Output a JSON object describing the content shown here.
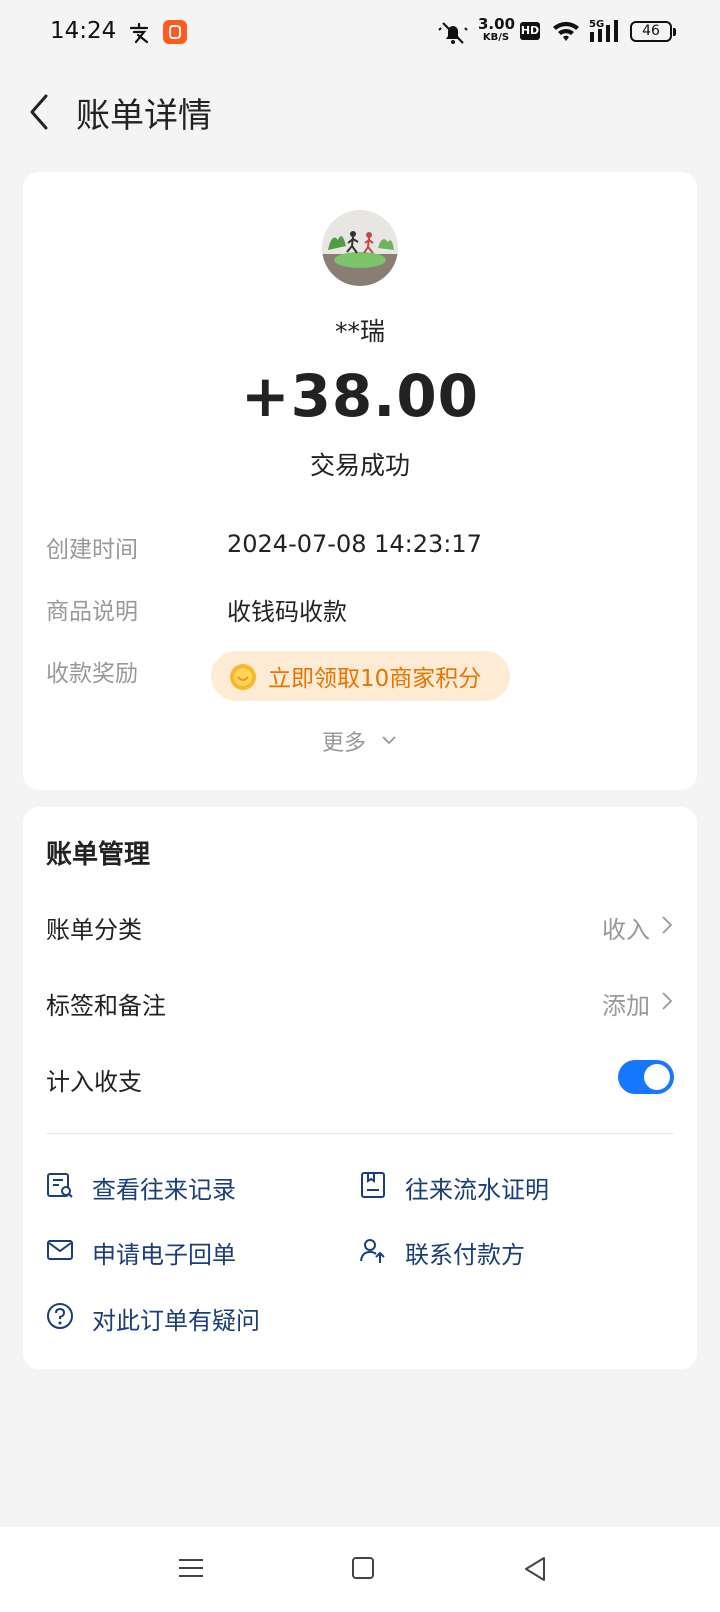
{
  "status_bar": {
    "time": "14:24",
    "net_speed_value": "3.00",
    "net_speed_unit": "KB/S",
    "hd": "HD",
    "battery": "46"
  },
  "header": {
    "title": "账单详情"
  },
  "transaction": {
    "payer_name": "**瑞",
    "amount": "+38.00",
    "status": "交易成功",
    "details": [
      {
        "label": "创建时间",
        "value": "2024-07-08 14:23:17"
      },
      {
        "label": "商品说明",
        "value": "收钱码收款"
      },
      {
        "label": "收款奖励",
        "value": "立即领取10商家积分"
      }
    ],
    "more_label": "更多"
  },
  "management": {
    "title": "账单管理",
    "rows": [
      {
        "label": "账单分类",
        "value": "收入"
      },
      {
        "label": "标签和备注",
        "value": "添加"
      },
      {
        "label": "计入收支",
        "toggle_on": true
      }
    ],
    "links": [
      {
        "label": "查看往来记录",
        "icon": "record-search-icon"
      },
      {
        "label": "往来流水证明",
        "icon": "statement-icon"
      },
      {
        "label": "申请电子回单",
        "icon": "mail-icon"
      },
      {
        "label": "联系付款方",
        "icon": "contact-user-icon"
      },
      {
        "label": "对此订单有疑问",
        "icon": "question-icon"
      }
    ]
  },
  "colors": {
    "accent": "#1677ff",
    "link": "#1a3e79",
    "reward_text": "#e87400",
    "reward_bg": "#fdebd6",
    "background": "#f4f4f4"
  }
}
